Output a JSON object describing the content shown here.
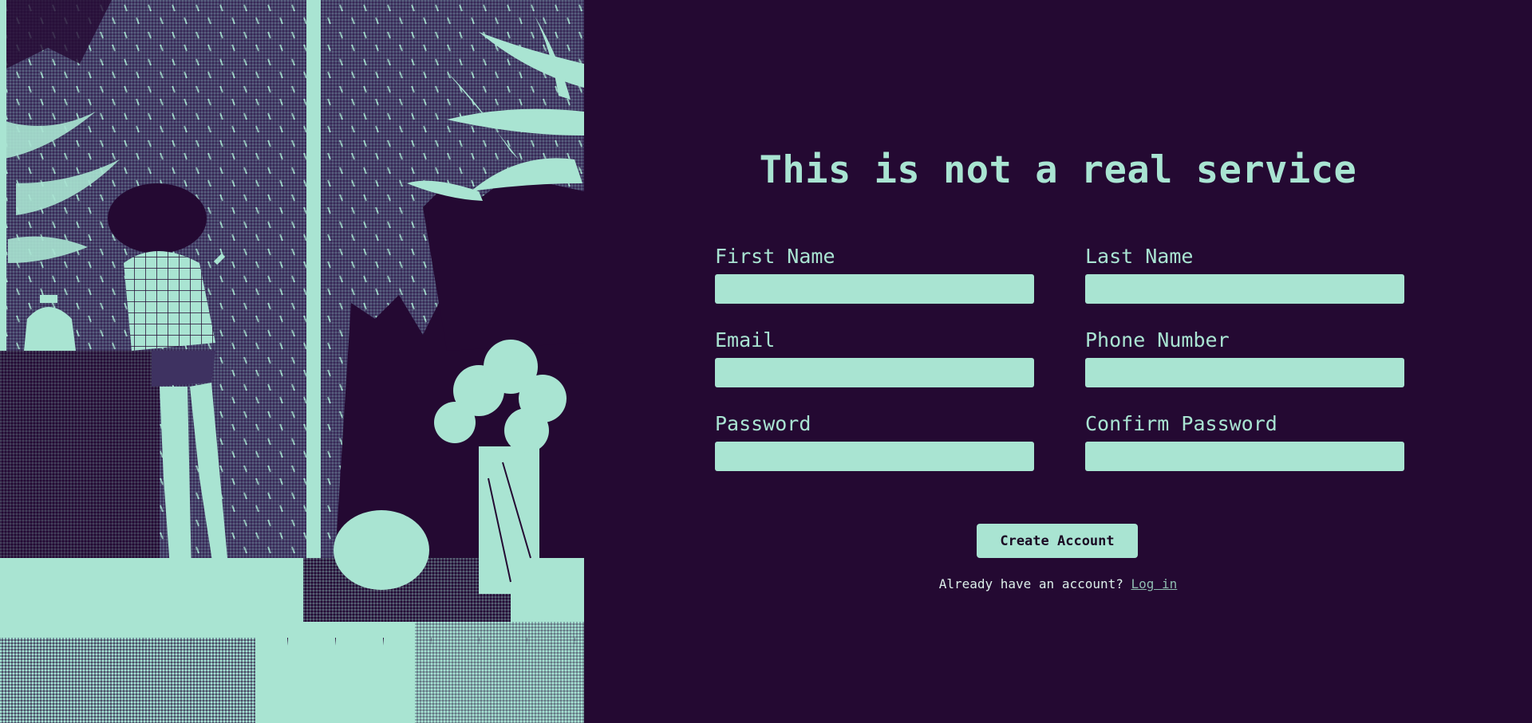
{
  "page": {
    "heading": "This is not a real service"
  },
  "form": {
    "fields": [
      {
        "label": "First Name",
        "value": ""
      },
      {
        "label": "Last Name",
        "value": ""
      },
      {
        "label": "Email",
        "value": ""
      },
      {
        "label": "Phone Number",
        "value": ""
      },
      {
        "label": "Password",
        "value": ""
      },
      {
        "label": "Confirm Password",
        "value": ""
      }
    ],
    "submit_label": "Create Account"
  },
  "footer": {
    "prompt": "Already have an account?",
    "link_label": "Log in"
  },
  "colors": {
    "background": "#240932",
    "accent": "#a9e4d2",
    "link": "#8fbcb0"
  }
}
